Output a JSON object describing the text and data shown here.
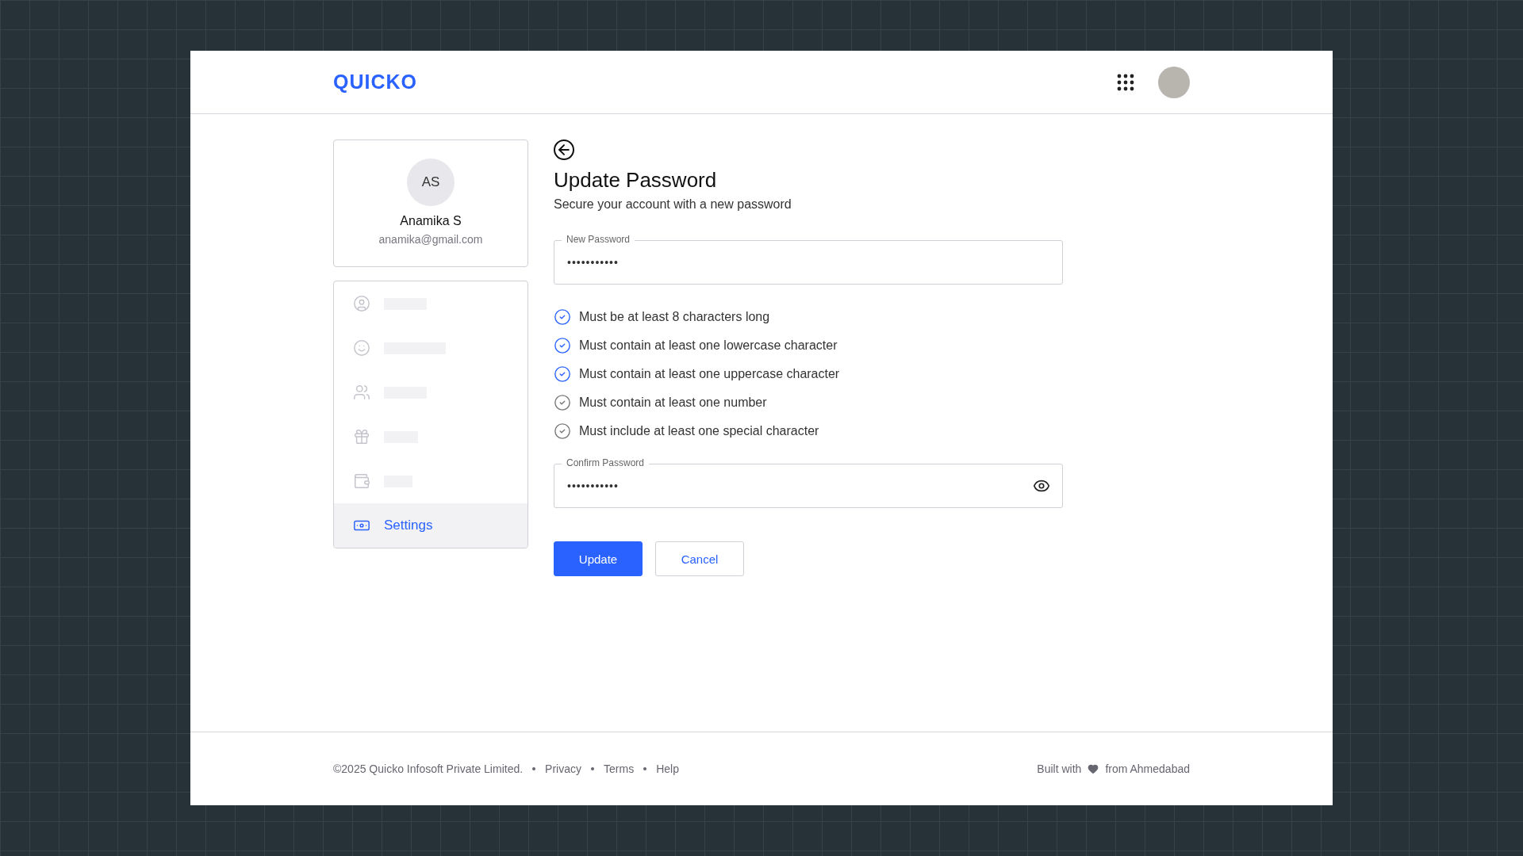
{
  "header": {
    "logo": "QUICKO"
  },
  "profile": {
    "initials": "AS",
    "name": "Anamika S",
    "email": "anamika@gmail.com"
  },
  "sidebar": {
    "items": [
      {
        "kind": "skeleton",
        "selected": false
      },
      {
        "kind": "skeleton",
        "selected": false
      },
      {
        "kind": "skeleton",
        "selected": false
      },
      {
        "kind": "skeleton",
        "selected": false
      },
      {
        "kind": "skeleton",
        "selected": false
      },
      {
        "kind": "label",
        "label": "Settings",
        "selected": true
      }
    ]
  },
  "form": {
    "title": "Update Password",
    "subtitle": "Secure your account with a new password",
    "new_password": {
      "label": "New Password",
      "value": "•••••••••••"
    },
    "requirements": [
      {
        "text": "Must be at least 8 characters long",
        "met": true
      },
      {
        "text": "Must contain at least one lowercase character",
        "met": true
      },
      {
        "text": "Must contain at least one uppercase character",
        "met": true
      },
      {
        "text": "Must contain at least one number",
        "met": false
      },
      {
        "text": "Must include at least one special character",
        "met": false
      }
    ],
    "confirm_password": {
      "label": "Confirm Password",
      "value": "•••••••••••"
    },
    "buttons": [
      {
        "kind": "primary",
        "label": "Update"
      },
      {
        "kind": "secondary",
        "label": "Cancel"
      }
    ]
  },
  "footer": {
    "copyright": "©2025 Quicko Infosoft Private Limited.",
    "links": [
      "Privacy",
      "Terms",
      "Help"
    ],
    "built_with": "Built with",
    "from": "from Ahmedabad"
  }
}
